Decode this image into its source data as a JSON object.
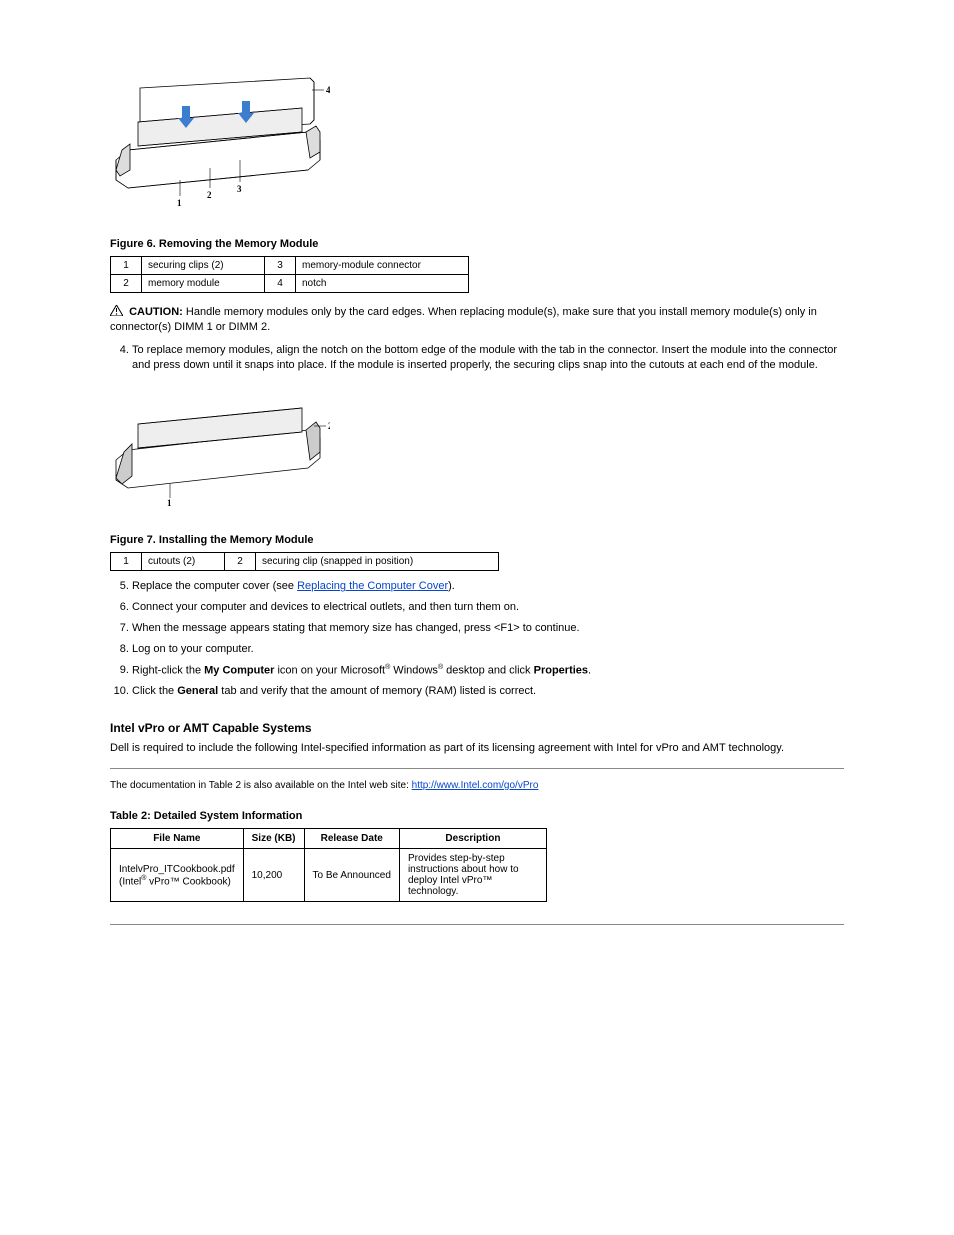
{
  "figure1": {
    "caption": "Figure 6. Removing the Memory Module",
    "labels": [
      [
        "1",
        "securing clips (2)",
        "3",
        "memory-module connector"
      ],
      [
        "2",
        "memory module",
        "4",
        "notch"
      ]
    ]
  },
  "caution": {
    "label": "CAUTION:",
    "text": "Handle memory modules only by the card edges. When replacing module(s), make sure that you install memory module(s) only in connector(s) DIMM 1 or DIMM 2."
  },
  "steps_a": [
    "To replace memory modules, align the notch on the bottom edge of the module with the tab in the connector. Insert the module into the connector and press down until it snaps into place. If the module is inserted properly, the securing clips snap into the cutouts at each end of the module."
  ],
  "figure2": {
    "caption": "Figure 7. Installing the Memory Module",
    "labels": [
      [
        "1",
        "cutouts (2)",
        "2",
        "securing clip (snapped in position)"
      ]
    ]
  },
  "steps_b": [
    {
      "text_before": "Replace the computer cover (see ",
      "link": "Replacing the Computer Cover",
      "text_after": ")."
    },
    {
      "text_before": "Connect your computer and devices to electrical outlets, and then turn them on."
    },
    {
      "text_before": "When the message appears stating that memory size has changed, press <F1> to continue."
    },
    {
      "text_before": "Log on to your computer."
    },
    {
      "text_before_html": "Right-click the <b>My Computer</b> icon on your Microsoft",
      "reg1": "®",
      "text_mid": " Windows",
      "reg2": "®",
      "text_mid2": " desktop and click ",
      "bold": "Properties",
      "text_after": "."
    },
    {
      "text_before": "Click the ",
      "bold": "General",
      "text_after": " tab and verify that the amount of memory (RAM) listed is correct."
    }
  ],
  "section_iamt": {
    "title": "Intel vPro or AMT Capable Systems",
    "body": "Dell is required to include the following Intel-specified information as part of its licensing agreement with Intel for vPro and AMT technology."
  },
  "table2": {
    "title": "Table 2: Detailed System Information",
    "link": "http://www.Intel.com/go/vPro",
    "caption_before": "The documentation in Table 2 is also available on the Intel web site: ",
    "headers": [
      "File Name",
      "Size (KB)",
      "Release Date",
      "Description"
    ],
    "rows": [
      [
        "IntelvPro_ITCookbook.pdf (Intel® vPro™ Cookbook)",
        "10,200",
        "To Be Announced",
        "Provides step-by-step instructions about how to deploy Intel vPro™ technology."
      ]
    ]
  }
}
